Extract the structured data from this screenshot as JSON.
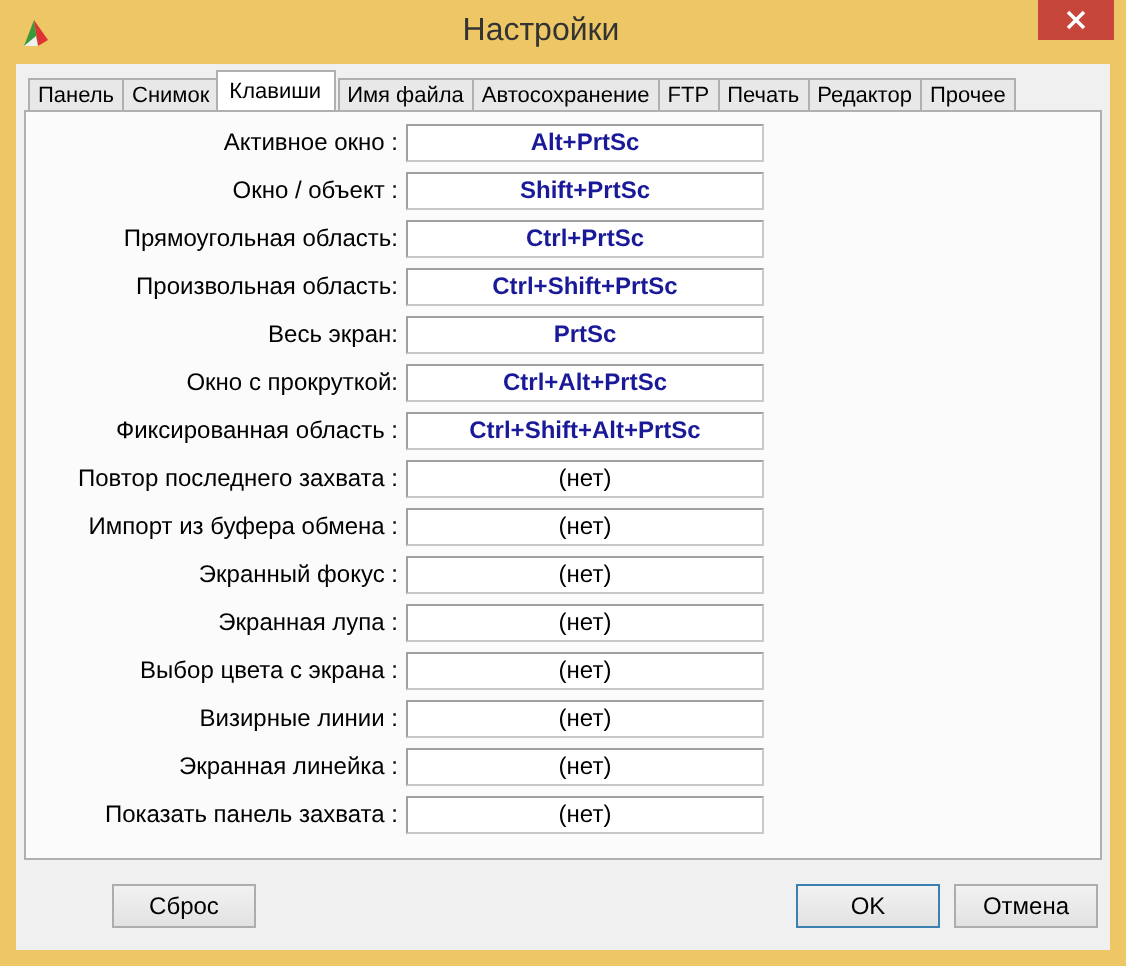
{
  "window": {
    "title": "Настройки"
  },
  "tabs": [
    {
      "label": "Панель",
      "selected": false
    },
    {
      "label": "Снимок",
      "selected": false
    },
    {
      "label": "Клавиши",
      "selected": true
    },
    {
      "label": "Имя файла",
      "selected": false
    },
    {
      "label": "Автосохранение",
      "selected": false
    },
    {
      "label": "FTP",
      "selected": false
    },
    {
      "label": "Печать",
      "selected": false
    },
    {
      "label": "Редактор",
      "selected": false
    },
    {
      "label": "Прочее",
      "selected": false
    }
  ],
  "hotkeys": [
    {
      "label": "Активное окно :",
      "value": "Alt+PrtSc",
      "assigned": true
    },
    {
      "label": "Окно / объект :",
      "value": "Shift+PrtSc",
      "assigned": true
    },
    {
      "label": "Прямоугольная область:",
      "value": "Ctrl+PrtSc",
      "assigned": true
    },
    {
      "label": "Произвольная область:",
      "value": "Ctrl+Shift+PrtSc",
      "assigned": true
    },
    {
      "label": "Весь экран:",
      "value": "PrtSc",
      "assigned": true
    },
    {
      "label": "Окно с прокруткой:",
      "value": "Ctrl+Alt+PrtSc",
      "assigned": true
    },
    {
      "label": "Фиксированная область :",
      "value": "Ctrl+Shift+Alt+PrtSc",
      "assigned": true
    },
    {
      "label": "Повтор последнего захвата :",
      "value": "(нет)",
      "assigned": false
    },
    {
      "label": "Импорт из буфера обмена :",
      "value": "(нет)",
      "assigned": false
    },
    {
      "label": "Экранный фокус :",
      "value": "(нет)",
      "assigned": false
    },
    {
      "label": "Экранная лупа :",
      "value": "(нет)",
      "assigned": false
    },
    {
      "label": "Выбор цвета с экрана :",
      "value": "(нет)",
      "assigned": false
    },
    {
      "label": "Визирные линии :",
      "value": "(нет)",
      "assigned": false
    },
    {
      "label": "Экранная линейка :",
      "value": "(нет)",
      "assigned": false
    },
    {
      "label": "Показать панель захвата :",
      "value": "(нет)",
      "assigned": false
    }
  ],
  "buttons": {
    "reset": "Сброс",
    "ok": "OK",
    "cancel": "Отмена"
  }
}
